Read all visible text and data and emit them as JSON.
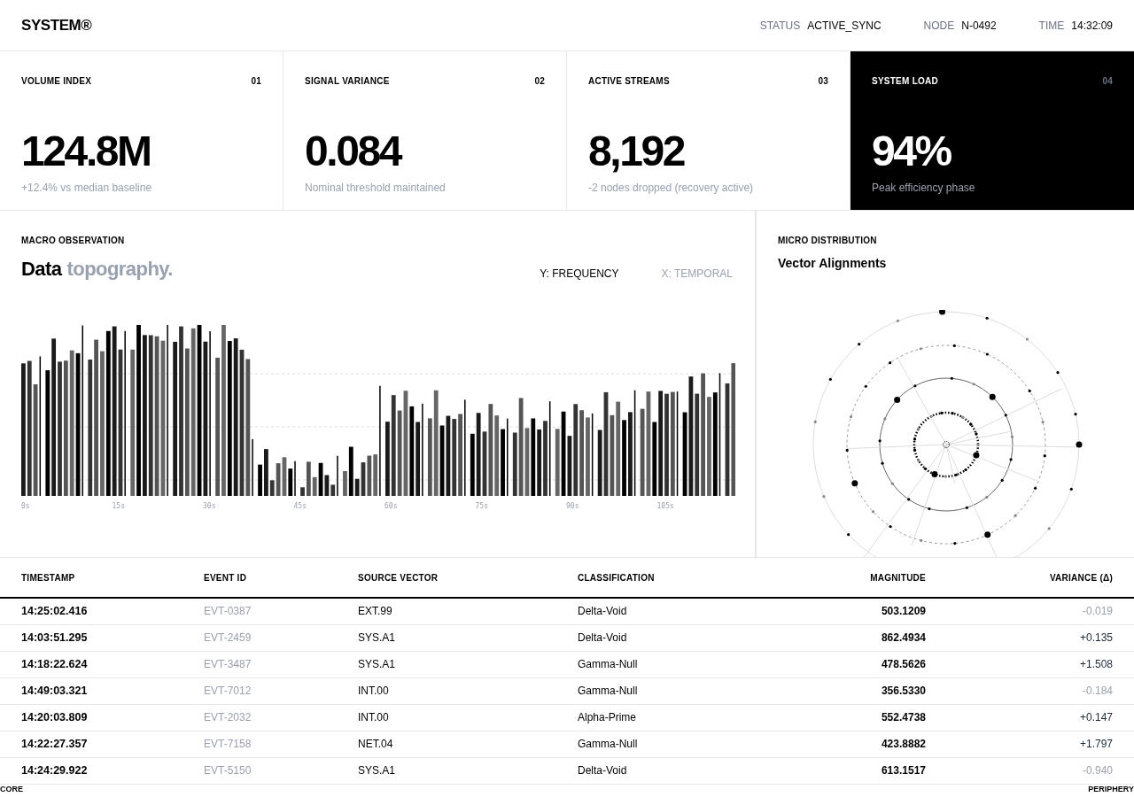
{
  "header": {
    "logo": "SYSTEM®",
    "status_label": "STATUS",
    "status_value": "ACTIVE_SYNC",
    "node_label": "NODE",
    "node_value": "N-0492",
    "time_label": "TIME",
    "time_value": "14:32:09"
  },
  "kpis": [
    {
      "label": "VOLUME INDEX",
      "index": "01",
      "value": "124.8M",
      "note": "+12.4% vs median baseline",
      "selected": false
    },
    {
      "label": "SIGNAL VARIANCE",
      "index": "02",
      "value": "0.084",
      "note": "Nominal threshold maintained",
      "selected": false
    },
    {
      "label": "ACTIVE STREAMS",
      "index": "03",
      "value": "8,192",
      "note": "-2 nodes dropped (recovery active)",
      "selected": false
    },
    {
      "label": "SYSTEM LOAD",
      "index": "04",
      "value": "94%",
      "note": "Peak efficiency phase",
      "selected": true
    }
  ],
  "macro": {
    "eyebrow": "MACRO OBSERVATION",
    "title_main": "Data",
    "title_accent": "topography.",
    "y_axis": "Y: FREQUENCY",
    "x_axis": "X: TEMPORAL",
    "x_labels": [
      "0s",
      "15s",
      "30s",
      "45s",
      "60s",
      "75s",
      "90s",
      "105s"
    ]
  },
  "micro": {
    "eyebrow": "MICRO DISTRIBUTION",
    "title": "Vector Alignments",
    "core_label": "CORE",
    "periphery_label": "PERIPHERY"
  },
  "table": {
    "columns": [
      "TIMESTAMP",
      "EVENT ID",
      "SOURCE VECTOR",
      "CLASSIFICATION",
      "MAGNITUDE",
      "VARIANCE (Δ)"
    ],
    "rows": [
      [
        "14:25:02.416",
        "EVT-0387",
        "EXT.99",
        "Delta-Void",
        "503.1209",
        "-0.019"
      ],
      [
        "14:03:51.295",
        "EVT-2459",
        "SYS.A1",
        "Delta-Void",
        "862.4934",
        "+0.135"
      ],
      [
        "14:18:22.624",
        "EVT-3487",
        "SYS.A1",
        "Gamma-Null",
        "478.5626",
        "+1.508"
      ],
      [
        "14:49:03.321",
        "EVT-7012",
        "INT.00",
        "Gamma-Null",
        "356.5330",
        "-0.184"
      ],
      [
        "14:20:03.809",
        "EVT-2032",
        "INT.00",
        "Alpha-Prime",
        "552.4738",
        "+0.147"
      ],
      [
        "14:22:27.357",
        "EVT-7158",
        "NET.04",
        "Gamma-Null",
        "423.8882",
        "+1.797"
      ],
      [
        "14:24:29.922",
        "EVT-5150",
        "SYS.A1",
        "Delta-Void",
        "613.1517",
        "-0.940"
      ]
    ]
  }
}
